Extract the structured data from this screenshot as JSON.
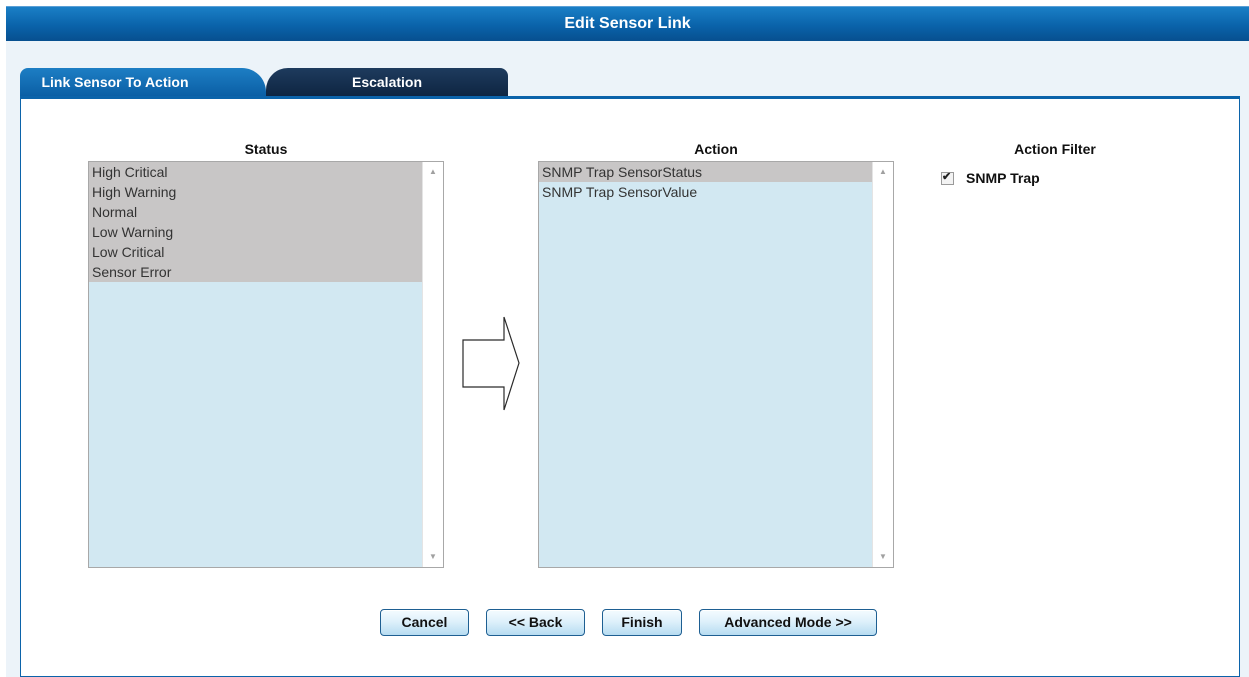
{
  "window": {
    "title": "Edit Sensor Link"
  },
  "tabs": [
    {
      "label": "Link Sensor To Action",
      "active": true
    },
    {
      "label": "Escalation",
      "active": false
    }
  ],
  "status_list": {
    "heading": "Status",
    "items": [
      "High Critical",
      "High Warning",
      "Normal",
      "Low Warning",
      "Low Critical",
      "Sensor Error"
    ]
  },
  "action_list": {
    "heading": "Action",
    "items": [
      "SNMP Trap SensorStatus",
      "SNMP Trap SensorValue"
    ]
  },
  "action_filter": {
    "heading": "Action Filter",
    "option_label": "SNMP Trap",
    "checked": true
  },
  "buttons": {
    "cancel": "Cancel",
    "back": "<< Back",
    "finish": "Finish",
    "advanced": "Advanced Mode >>"
  },
  "colors": {
    "title_bar": "#0b63aa",
    "active_tab": "#0b5fa5",
    "inactive_tab": "#0e2542",
    "list_background": "#d2e8f2",
    "selected_item": "#c8c6c6"
  }
}
